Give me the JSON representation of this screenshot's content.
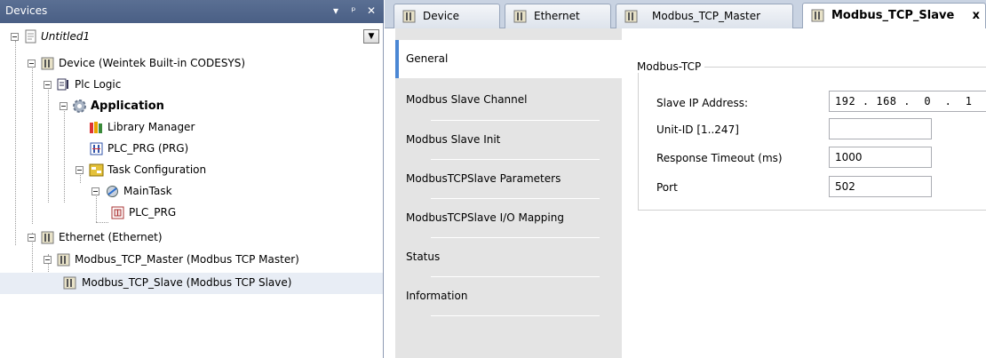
{
  "devices_pane": {
    "title": "Devices",
    "controls": {
      "dropdown": "▾",
      "pin": "ᵖ",
      "close": "✕"
    },
    "tree": [
      {
        "label": "Untitled1",
        "icon": "project-icon",
        "style": "italic"
      },
      {
        "label": "Device (Weintek Built-in CODESYS)",
        "icon": "device-icon"
      },
      {
        "label": "Plc Logic",
        "icon": "plc-logic-icon"
      },
      {
        "label": "Application",
        "icon": "application-gear-icon",
        "style": "bold"
      },
      {
        "label": "Library Manager",
        "icon": "library-manager-icon"
      },
      {
        "label": "PLC_PRG (PRG)",
        "icon": "program-icon"
      },
      {
        "label": "Task Configuration",
        "icon": "task-configuration-icon"
      },
      {
        "label": "MainTask",
        "icon": "main-task-icon"
      },
      {
        "label": "PLC_PRG",
        "icon": "task-call-icon"
      },
      {
        "label": "Ethernet (Ethernet)",
        "icon": "device-icon"
      },
      {
        "label": "Modbus_TCP_Master (Modbus TCP Master)",
        "icon": "device-icon"
      },
      {
        "label": "Modbus_TCP_Slave (Modbus TCP Slave)",
        "icon": "device-icon",
        "selected": true
      }
    ]
  },
  "editor": {
    "tabs": [
      {
        "label": "Device"
      },
      {
        "label": "Ethernet"
      },
      {
        "label": "Modbus_TCP_Master"
      },
      {
        "label": "Modbus_TCP_Slave",
        "active": true,
        "close": "x"
      }
    ],
    "side_tabs": [
      {
        "label": "General",
        "active": true
      },
      {
        "label": "Modbus Slave Channel"
      },
      {
        "label": "Modbus Slave Init"
      },
      {
        "label": "ModbusTCPSlave Parameters"
      },
      {
        "label": "ModbusTCPSlave I/O Mapping"
      },
      {
        "label": "Status"
      },
      {
        "label": "Information"
      }
    ],
    "general": {
      "group_title": "Modbus-TCP",
      "fields": [
        {
          "label": "Slave IP Address:",
          "value": "192 . 168 .  0  .  1"
        },
        {
          "label": "Unit-ID [1..247]",
          "value": ""
        },
        {
          "label": "Response Timeout (ms)",
          "value": "1000"
        },
        {
          "label": "Port",
          "value": "502"
        }
      ]
    }
  },
  "colors": {
    "pane_header": "#4f6489",
    "tab_bar": "#c9d3e2",
    "active_side_accent": "#4b87d4",
    "side_panel": "#e4e4e4",
    "selected_row": "#e8edf5"
  }
}
